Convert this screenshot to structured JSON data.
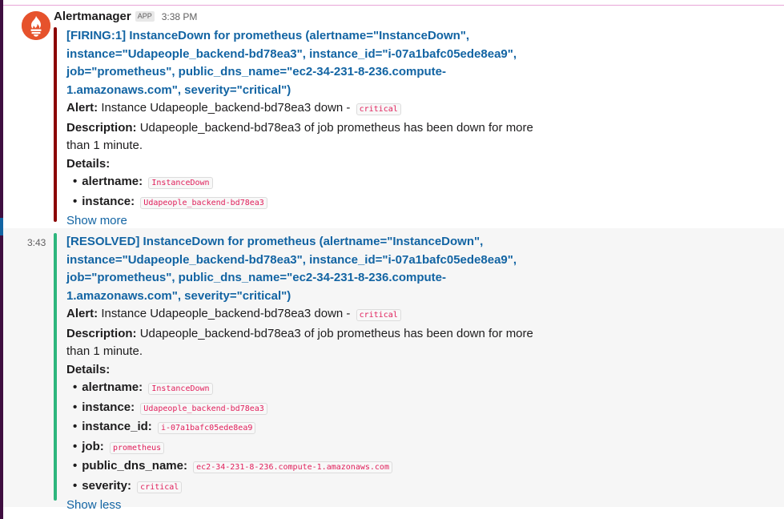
{
  "sender": "Alertmanager",
  "app_badge": "APP",
  "time": "3:38 PM",
  "firing": {
    "bar_color": "#8b0000",
    "title_lines": [
      "[FIRING:1] InstanceDown for prometheus (alertname=\"InstanceDown\",",
      "instance=\"Udapeople_backend-bd78ea3\", instance_id=\"i-07a1bafc05ede8ea9\",",
      "job=\"prometheus\", public_dns_name=\"ec2-34-231-8-236.compute-",
      "1.amazonaws.com\", severity=\"critical\")"
    ],
    "alert_label": "Alert:",
    "alert_text": "Instance Udapeople_backend-bd78ea3 down -",
    "alert_code": "critical",
    "desc_label": "Description:",
    "desc_line1": "Udapeople_backend-bd78ea3 of job prometheus has been down for more",
    "desc_line2": "than 1 minute.",
    "details_label": "Details:",
    "details": [
      {
        "key": "alertname:",
        "value": "InstanceDown"
      },
      {
        "key": "instance:",
        "value": "Udapeople_backend-bd78ea3"
      }
    ],
    "toggle": "Show more"
  },
  "resolved": {
    "time": "3:43",
    "bar_color": "#2eb67d",
    "title_lines": [
      "[RESOLVED] InstanceDown for prometheus (alertname=\"InstanceDown\",",
      "instance=\"Udapeople_backend-bd78ea3\", instance_id=\"i-07a1bafc05ede8ea9\",",
      "job=\"prometheus\", public_dns_name=\"ec2-34-231-8-236.compute-",
      "1.amazonaws.com\", severity=\"critical\")"
    ],
    "alert_label": "Alert:",
    "alert_text": "Instance Udapeople_backend-bd78ea3 down -",
    "alert_code": "critical",
    "desc_label": "Description:",
    "desc_line1": "Udapeople_backend-bd78ea3 of job prometheus has been down for more",
    "desc_line2": "than 1 minute.",
    "details_label": "Details:",
    "details": [
      {
        "key": "alertname:",
        "value": "InstanceDown"
      },
      {
        "key": "instance:",
        "value": "Udapeople_backend-bd78ea3"
      },
      {
        "key": "instance_id:",
        "value": "i-07a1bafc05ede8ea9"
      },
      {
        "key": "job:",
        "value": "prometheus"
      },
      {
        "key": "public_dns_name:",
        "value": "ec2-34-231-8-236.compute-1.amazonaws.com"
      },
      {
        "key": "severity:",
        "value": "critical"
      }
    ],
    "toggle": "Show less"
  },
  "icons": {
    "avatar": "prometheus-flame-icon",
    "bullet": "bullet-dot-icon"
  },
  "colors": {
    "link": "#1264a3",
    "code": "#e01e5a",
    "sidebar": "#3f0e40"
  }
}
